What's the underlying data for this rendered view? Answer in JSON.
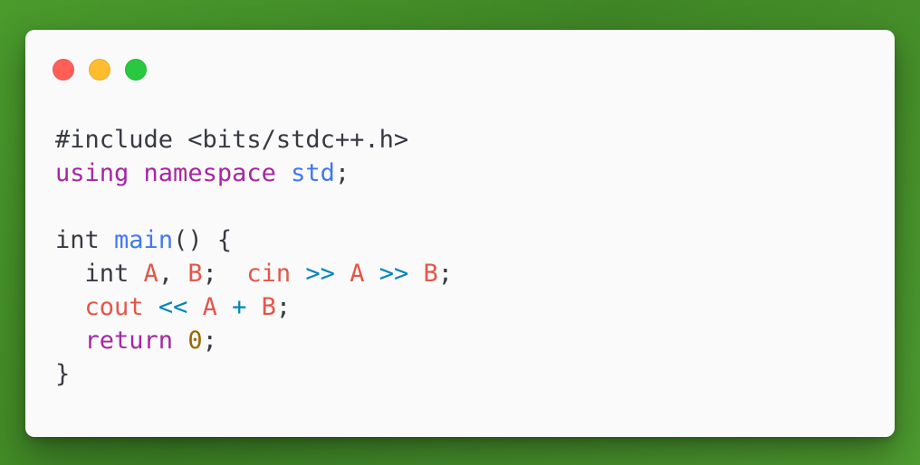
{
  "window_controls": {
    "close_color": "#ff5f57",
    "minimize_color": "#febc2e",
    "maximize_color": "#28c840"
  },
  "code": {
    "lines": [
      [
        {
          "text": "#include <bits/stdc++.h>",
          "role": "plain"
        }
      ],
      [
        {
          "text": "using",
          "role": "keyword"
        },
        {
          "text": " ",
          "role": "plain"
        },
        {
          "text": "namespace",
          "role": "keyword"
        },
        {
          "text": " ",
          "role": "plain"
        },
        {
          "text": "std",
          "role": "function"
        },
        {
          "text": ";",
          "role": "plain"
        }
      ],
      [],
      [
        {
          "text": "int",
          "role": "plain"
        },
        {
          "text": " ",
          "role": "plain"
        },
        {
          "text": "main",
          "role": "function"
        },
        {
          "text": "() {",
          "role": "plain"
        }
      ],
      [
        {
          "text": "  int ",
          "role": "plain"
        },
        {
          "text": "A",
          "role": "variable"
        },
        {
          "text": ", ",
          "role": "plain"
        },
        {
          "text": "B",
          "role": "variable"
        },
        {
          "text": ";  ",
          "role": "plain"
        },
        {
          "text": "cin",
          "role": "variable"
        },
        {
          "text": " ",
          "role": "plain"
        },
        {
          "text": ">>",
          "role": "operator"
        },
        {
          "text": " ",
          "role": "plain"
        },
        {
          "text": "A",
          "role": "variable"
        },
        {
          "text": " ",
          "role": "plain"
        },
        {
          "text": ">>",
          "role": "operator"
        },
        {
          "text": " ",
          "role": "plain"
        },
        {
          "text": "B",
          "role": "variable"
        },
        {
          "text": ";",
          "role": "plain"
        }
      ],
      [
        {
          "text": "  ",
          "role": "plain"
        },
        {
          "text": "cout",
          "role": "variable"
        },
        {
          "text": " ",
          "role": "plain"
        },
        {
          "text": "<<",
          "role": "operator"
        },
        {
          "text": " ",
          "role": "plain"
        },
        {
          "text": "A",
          "role": "variable"
        },
        {
          "text": " ",
          "role": "plain"
        },
        {
          "text": "+",
          "role": "operator"
        },
        {
          "text": " ",
          "role": "plain"
        },
        {
          "text": "B",
          "role": "variable"
        },
        {
          "text": ";",
          "role": "plain"
        }
      ],
      [
        {
          "text": "  ",
          "role": "plain"
        },
        {
          "text": "return",
          "role": "keyword"
        },
        {
          "text": " ",
          "role": "plain"
        },
        {
          "text": "0",
          "role": "number"
        },
        {
          "text": ";",
          "role": "plain"
        }
      ],
      [
        {
          "text": "}",
          "role": "plain"
        }
      ]
    ]
  },
  "syntax_colors": {
    "plain": "#383a42",
    "keyword": "#a626a4",
    "function": "#4078f2",
    "variable": "#e45649",
    "operator": "#0184bc",
    "number": "#986801"
  }
}
